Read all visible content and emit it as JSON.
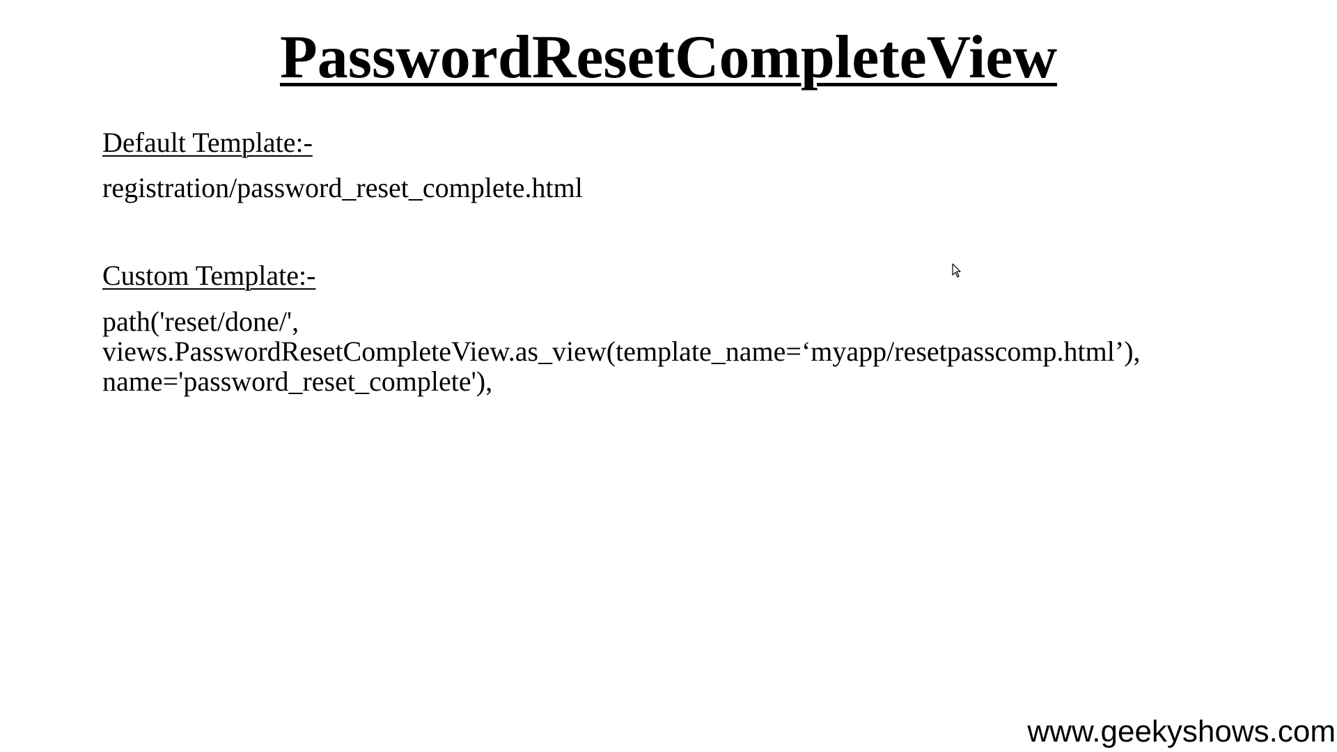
{
  "slide": {
    "title": "PasswordResetCompleteView",
    "default_section": {
      "heading": "Default Template:-",
      "body": "registration/password_reset_complete.html"
    },
    "custom_section": {
      "heading": "Custom Template:-",
      "code_lines": [
        "path('reset/done/',",
        "views.PasswordResetCompleteView.as_view(template_name=‘myapp/resetpasscomp.html’),",
        "name='password_reset_complete'),"
      ]
    },
    "watermark": "www.geekyshows.com"
  },
  "icons": {
    "cursor": "mouse-pointer-icon"
  }
}
